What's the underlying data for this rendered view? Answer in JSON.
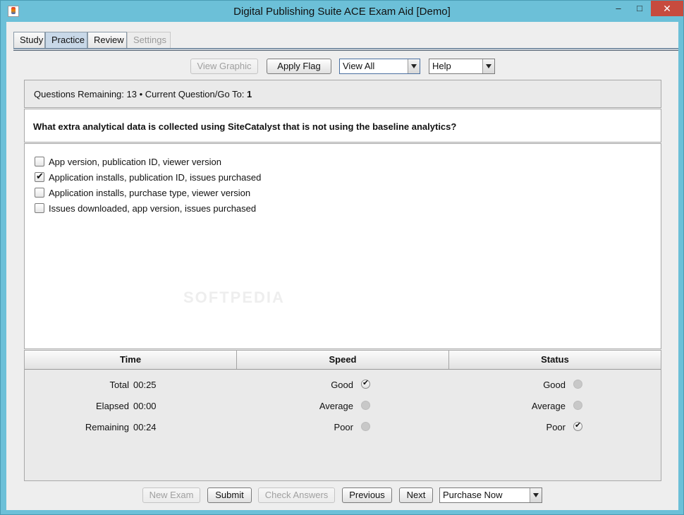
{
  "window": {
    "title": "Digital Publishing Suite ACE Exam Aid [Demo]",
    "minimize": "–",
    "maximize": "□",
    "close": "✕"
  },
  "tabs": [
    {
      "label": "Study",
      "state": "normal"
    },
    {
      "label": "Practice",
      "state": "active"
    },
    {
      "label": "Review",
      "state": "normal"
    },
    {
      "label": "Settings",
      "state": "disabled"
    }
  ],
  "toolbar": {
    "view_graphic": "View Graphic",
    "apply_flag": "Apply Flag",
    "view_combo": "View All",
    "help_combo": "Help"
  },
  "status": {
    "prefix": "Questions Remaining: 13 • Current Question/Go To:",
    "current": "1"
  },
  "question": {
    "text": "What extra analytical data is collected using SiteCatalyst that is not using the baseline analytics?"
  },
  "answers": [
    {
      "label": "App version, publication ID, viewer version",
      "checked": false
    },
    {
      "label": "Application installs, publication ID, issues purchased",
      "checked": true
    },
    {
      "label": "Application installs, purchase type, viewer version",
      "checked": false
    },
    {
      "label": "Issues downloaded, app version, issues purchased",
      "checked": false
    }
  ],
  "watermark": "SOFTPEDIA",
  "stats": {
    "headers": {
      "time": "Time",
      "speed": "Speed",
      "status": "Status"
    },
    "time": [
      {
        "label": "Total",
        "value": "00:25"
      },
      {
        "label": "Elapsed",
        "value": "00:00"
      },
      {
        "label": "Remaining",
        "value": "00:24"
      }
    ],
    "speed": [
      {
        "label": "Good",
        "checked": true
      },
      {
        "label": "Average",
        "checked": false
      },
      {
        "label": "Poor",
        "checked": false
      }
    ],
    "status": [
      {
        "label": "Good",
        "checked": false
      },
      {
        "label": "Average",
        "checked": false
      },
      {
        "label": "Poor",
        "checked": true
      }
    ]
  },
  "bottom": {
    "new_exam": "New Exam",
    "submit": "Submit",
    "check_answers": "Check Answers",
    "previous": "Previous",
    "next": "Next",
    "purchase_combo": "Purchase Now"
  }
}
